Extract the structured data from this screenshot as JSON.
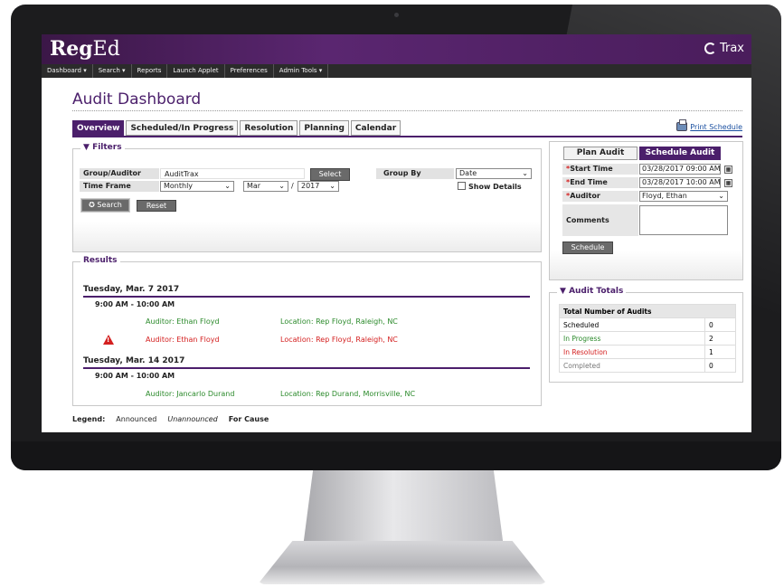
{
  "app": {
    "logo_bold": "Reg",
    "logo_light": "Ed",
    "product": "Trax"
  },
  "nav": [
    "Dashboard ▾",
    "Search ▾",
    "Reports",
    "Launch Applet",
    "Preferences",
    "Admin Tools ▾"
  ],
  "page_title": "Audit Dashboard",
  "tabs": [
    "Overview",
    "Scheduled/In Progress",
    "Resolution",
    "Planning",
    "Calendar"
  ],
  "print_link": "Print Schedule",
  "filters": {
    "legend": "Filters",
    "group_auditor_label": "Group/Auditor",
    "group_auditor_value": "AuditTrax",
    "select_button": "Select",
    "group_by_label": "Group By",
    "group_by_value": "Date",
    "time_frame_label": "Time Frame",
    "time_frame_value": "Monthly",
    "month_value": "Mar",
    "separator": "/",
    "year_value": "2017",
    "show_details_label": "Show Details",
    "search_button": "Search",
    "reset_button": "Reset"
  },
  "results": {
    "legend": "Results",
    "days": [
      {
        "date": "Tuesday, Mar. 7 2017",
        "time": "9:00 AM - 10:00 AM",
        "rows": [
          {
            "auditor": "Auditor: Ethan Floyd",
            "location": "Location: Rep Floyd, Raleigh, NC",
            "status": "announced"
          },
          {
            "auditor": "Auditor: Ethan Floyd",
            "location": "Location: Rep Floyd, Raleigh, NC",
            "status": "for-cause"
          }
        ]
      },
      {
        "date": "Tuesday, Mar. 14 2017",
        "time": "9:00 AM - 10:00 AM",
        "rows": [
          {
            "auditor": "Auditor: Jancarlo Durand",
            "location": "Location: Rep Durand, Morrisville, NC",
            "status": "announced"
          }
        ]
      }
    ]
  },
  "legend": {
    "label": "Legend:",
    "announced": "Announced",
    "unannounced": "Unannounced",
    "for_cause": "For Cause"
  },
  "schedule": {
    "tab_plan": "Plan Audit",
    "tab_schedule": "Schedule Audit",
    "start_label": "Start Time",
    "start_value": "03/28/2017 09:00 AM",
    "end_label": "End Time",
    "end_value": "03/28/2017 10:00 AM",
    "auditor_label": "Auditor",
    "auditor_value": "Floyd, Ethan",
    "comments_label": "Comments",
    "required_mark": "*",
    "button": "Schedule"
  },
  "totals": {
    "legend": "Audit Totals",
    "header": "Total Number of Audits",
    "rows": [
      {
        "label": "Scheduled",
        "count": "0"
      },
      {
        "label": "In Progress",
        "count": "2"
      },
      {
        "label": "In Resolution",
        "count": "1"
      },
      {
        "label": "Completed",
        "count": "0"
      }
    ]
  },
  "colors": {
    "accent": "#4b1f6b",
    "in_progress": "#2b8a2b",
    "in_resolution": "#d42020",
    "link": "#1a4fa0"
  }
}
